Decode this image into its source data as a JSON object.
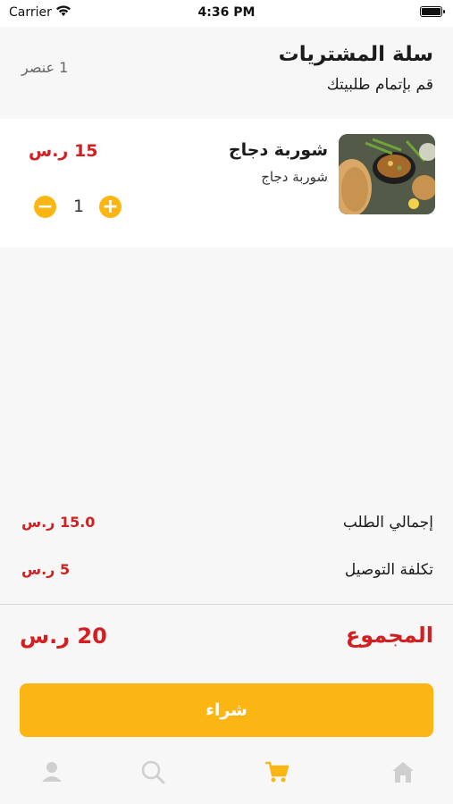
{
  "status_bar": {
    "carrier": "Carrier",
    "time": "4:36 PM"
  },
  "header": {
    "title": "سلة المشتريات",
    "subtitle": "قم بإتمام طلبيتك",
    "item_count": "1 عنصر"
  },
  "cart_items": [
    {
      "name": "شوربة دجاج",
      "description": "شوربة دجاج",
      "price": "15 ر.س",
      "quantity": "1",
      "minus": "−",
      "plus": "+"
    }
  ],
  "summary": {
    "order_total_label": "إجمالي الطلب",
    "order_total_value": "15.0 ر.س",
    "delivery_label": "تكلفة التوصيل",
    "delivery_value": "5 ر.س",
    "total_label": "المجموع",
    "total_value": "20 ر.س"
  },
  "buy_button": {
    "label": "شراء"
  },
  "tab_bar": {
    "tabs": [
      "profile-icon",
      "search-icon",
      "cart-icon",
      "home-icon"
    ],
    "active": "cart-icon"
  },
  "colors": {
    "accent": "#fbb614",
    "price": "#d21f1f",
    "inactive_icon": "#cfcfcf"
  }
}
